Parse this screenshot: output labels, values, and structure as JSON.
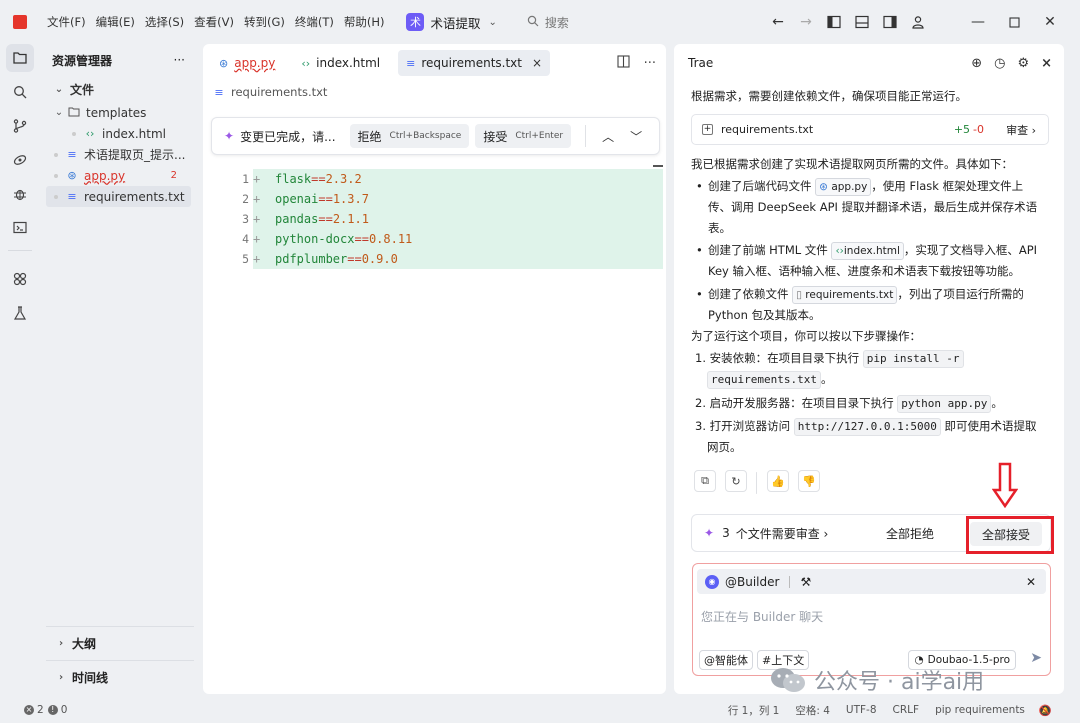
{
  "titlebar": {
    "menus": [
      "文件(F)",
      "编辑(E)",
      "选择(S)",
      "查看(V)",
      "转到(G)",
      "终端(T)",
      "帮助(H)"
    ],
    "project_icon": "术",
    "project_name": "术语提取",
    "search_label": "搜索"
  },
  "explorer": {
    "title": "资源管理器",
    "more": "···",
    "section": "文件",
    "items": [
      {
        "label": "templates",
        "icon": "folder-icon"
      },
      {
        "label": "index.html",
        "icon": "code-icon"
      },
      {
        "label": "术语提取页_提示...",
        "icon": "lines-icon"
      },
      {
        "label": "app.py",
        "icon": "python-icon",
        "badge": "2"
      },
      {
        "label": "requirements.txt",
        "icon": "lines-icon"
      }
    ],
    "outline": "大纲",
    "timeline": "时间线"
  },
  "editor": {
    "tabs": [
      {
        "label": "app.py",
        "icon": "python-icon"
      },
      {
        "label": "index.html",
        "icon": "code-icon"
      },
      {
        "label": "requirements.txt",
        "icon": "lines-icon",
        "close": "×"
      }
    ],
    "breadcrumb": "requirements.txt",
    "review": {
      "text": "变更已完成，请...",
      "reject": "拒绝",
      "reject_kbd": "Ctrl+Backspace",
      "accept": "接受",
      "accept_kbd": "Ctrl+Enter"
    },
    "lines": [
      {
        "n": "1",
        "pkg": "flask",
        "op": "==",
        "ver": "2.3.2"
      },
      {
        "n": "2",
        "pkg": "openai",
        "op": "==",
        "ver": "1.3.7"
      },
      {
        "n": "3",
        "pkg": "pandas",
        "op": "==",
        "ver": "2.1.1"
      },
      {
        "n": "4",
        "pkg": "python-docx",
        "op": "==",
        "ver": "0.8.11"
      },
      {
        "n": "5",
        "pkg": "pdfplumber",
        "op": "==",
        "ver": "0.9.0"
      }
    ],
    "plus": "+"
  },
  "chat": {
    "title": "Trae",
    "intro": "根据需求，需要创建依赖文件，确保项目能正常运行。",
    "file_card": {
      "name": "requirements.txt",
      "added": "+5",
      "removed": "-0",
      "review": "审查"
    },
    "summary": "我已根据需求创建了实现术语提取网页所需的文件。具体如下：",
    "b1_pre": "创建了后端代码文件",
    "b1_file": "app.py",
    "b1_post": "，使用 Flask 框架处理文件上",
    "b1_line2": "传、调用 DeepSeek API 提取并翻译术语，最后生成并保存术语",
    "b1_line3": "表。",
    "b2_pre": "创建了前端 HTML 文件",
    "b2_file": "index.html",
    "b2_post": "，实现了文档导入框、API",
    "b2_line2": "Key 输入框、语种输入框、进度条和术语表下载按钮等功能。",
    "b3_pre": "创建了依赖文件",
    "b3_file": "requirements.txt",
    "b3_post": "，列出了项目运行所需的",
    "b3_line2": "Python 包及其版本。",
    "steps_intro": "为了运行这个项目，你可以按以下步骤操作：",
    "s1_pre": "1. 安装依赖：在项目目录下执行",
    "s1_code_a": "pip install -r",
    "s1_code_b": "requirements.txt",
    "s1_post": "。",
    "s2_pre": "2. 启动开发服务器：在项目目录下执行",
    "s2_code": "python app.py",
    "s2_post": "。",
    "s3_pre": "3. 打开浏览器访问",
    "s3_code": "http://127.0.0.1:5000",
    "s3_post": "即可使用术语提取",
    "s3_line2": "网页。",
    "files_review": {
      "count": "3",
      "text": "个文件需要审查",
      "reject_all": "全部拒绝",
      "accept_all": "全部接受"
    },
    "composer": {
      "agent": "@Builder",
      "placeholder": "您正在与 Builder 聊天",
      "chip_agent": "@智能体",
      "chip_context": "#上下文",
      "model": "Doubao-1.5-pro"
    }
  },
  "watermark": "公众号 · ai学ai用",
  "status": {
    "errors": "2",
    "warnings": "0",
    "position": "行 1，列 1",
    "spaces": "空格: 4",
    "encoding": "UTF-8",
    "eol": "CRLF",
    "language": "pip requirements"
  },
  "colors": {
    "accent": "#6d5cf6",
    "highlight_red": "#e5202a",
    "diff_bg": "#dff3ea",
    "error": "#d9342b"
  }
}
